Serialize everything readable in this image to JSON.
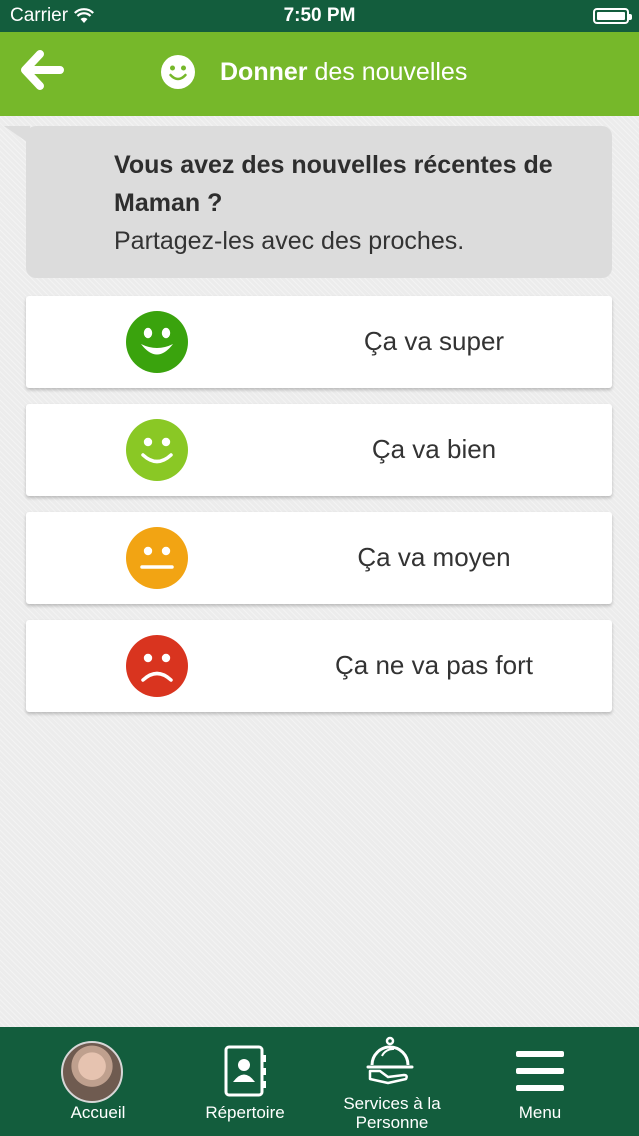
{
  "status_bar": {
    "carrier": "Carrier",
    "time": "7:50 PM"
  },
  "header": {
    "title_bold": "Donner",
    "title_rest": " des nouvelles"
  },
  "bubble": {
    "title": "Vous avez des nouvelles récentes de Maman ?",
    "subtitle": "Partagez-les avec des proches."
  },
  "options": [
    {
      "label": "Ça va super",
      "color": "#3aa30d"
    },
    {
      "label": "Ça va bien",
      "color": "#8ac825"
    },
    {
      "label": "Ça va moyen",
      "color": "#f2a413"
    },
    {
      "label": "Ça ne va pas fort",
      "color": "#d9341f"
    }
  ],
  "tab_bar": {
    "accueil": "Accueil",
    "repertoire": "Répertoire",
    "services": "Services à la Personne",
    "menu": "Menu"
  },
  "colors": {
    "header_green": "#76b82a",
    "dark_green": "#135d3d"
  }
}
